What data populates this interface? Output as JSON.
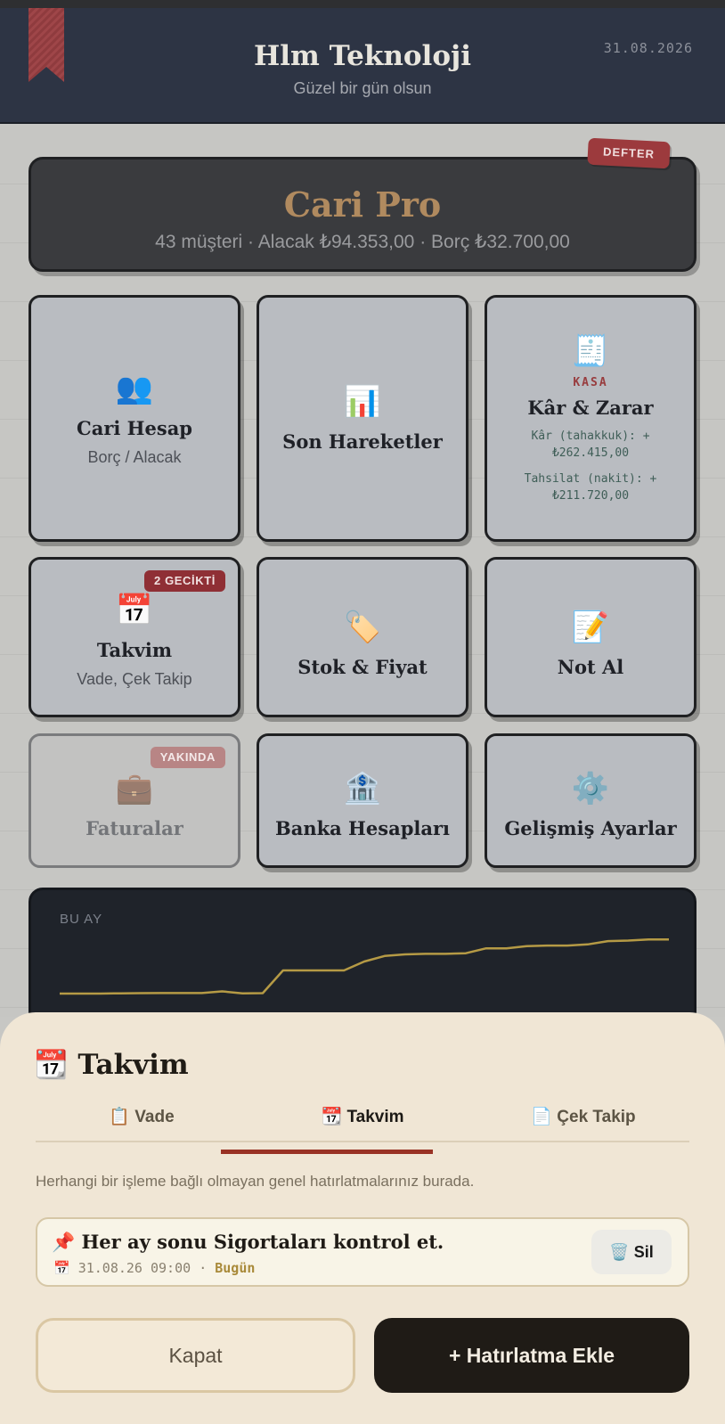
{
  "header": {
    "title": "Hlm Teknoloji",
    "subtitle": "Güzel bir gün olsun",
    "date": "31.08.2026"
  },
  "summary": {
    "badge": "DEFTER",
    "title": "Cari Pro",
    "stats": "43 müşteri · Alacak ₺94.353,00 · Borç ₺32.700,00"
  },
  "tiles": {
    "cari": {
      "icon": "👥",
      "title": "Cari Hesap",
      "subtitle": "Borç / Alacak"
    },
    "hareket": {
      "icon": "📊",
      "title": "Son Hareketler"
    },
    "kasa": {
      "icon": "🧾",
      "label": "KASA",
      "title": "Kâr & Zarar",
      "line1a": "Kâr (tahakkuk): +",
      "line1b": "₺262.415,00",
      "line2a": "Tahsilat (nakit): +",
      "line2b": "₺211.720,00"
    },
    "takvim": {
      "icon": "📅",
      "badge": "2 GECİKTİ",
      "title": "Takvim",
      "subtitle": "Vade, Çek Takip"
    },
    "stok": {
      "icon": "🏷️",
      "title": "Stok & Fiyat"
    },
    "not": {
      "icon": "📝",
      "title": "Not Al"
    },
    "fatura": {
      "icon": "💼",
      "badge": "YAKINDA",
      "title": "Faturalar"
    },
    "banka": {
      "icon": "🏦",
      "title": "Banka Hesapları"
    },
    "ayar": {
      "icon": "⚙️",
      "title": "Gelişmiş Ayarlar"
    }
  },
  "chart": {
    "label": "BU AY",
    "color": "#b59a45"
  },
  "chart_data": {
    "type": "line",
    "title": "",
    "xlabel": "",
    "ylabel": "",
    "x": [
      1,
      2,
      3,
      4,
      5,
      6,
      7,
      8,
      9,
      10,
      11,
      12,
      13,
      14,
      15,
      16,
      17,
      18,
      19,
      20,
      21,
      22,
      23,
      24,
      25,
      26,
      27,
      28,
      29,
      30,
      31
    ],
    "series": [
      {
        "values": [
          0,
          0,
          0,
          0.5,
          0.8,
          1,
          1,
          1,
          4,
          0.5,
          0.8,
          42,
          42,
          42,
          42,
          58,
          68,
          71,
          72,
          72,
          73,
          82,
          82,
          86,
          87,
          87,
          89,
          95,
          96,
          98,
          98
        ]
      }
    ],
    "ylim": [
      0,
      100
    ],
    "grid": false
  },
  "sheet": {
    "title_icon": "📆",
    "title": "Takvim",
    "tabs": [
      {
        "icon": "📋",
        "label": "Vade"
      },
      {
        "icon": "📆",
        "label": "Takvim"
      },
      {
        "icon": "📄",
        "label": "Çek Takip"
      }
    ],
    "description": "Herhangi bir işleme bağlı olmayan genel hatırlatmalarınız burada.",
    "reminder": {
      "icon": "📌",
      "text": "Her ay sonu Sigortaları kontrol et.",
      "meta_icon": "📅",
      "datetime": "31.08.26 09:00",
      "separator": "·",
      "status": "Bugün",
      "delete_icon": "🗑️",
      "delete_label": "Sil"
    },
    "close_label": "Kapat",
    "add_label": "+ Hatırlatma Ekle"
  }
}
